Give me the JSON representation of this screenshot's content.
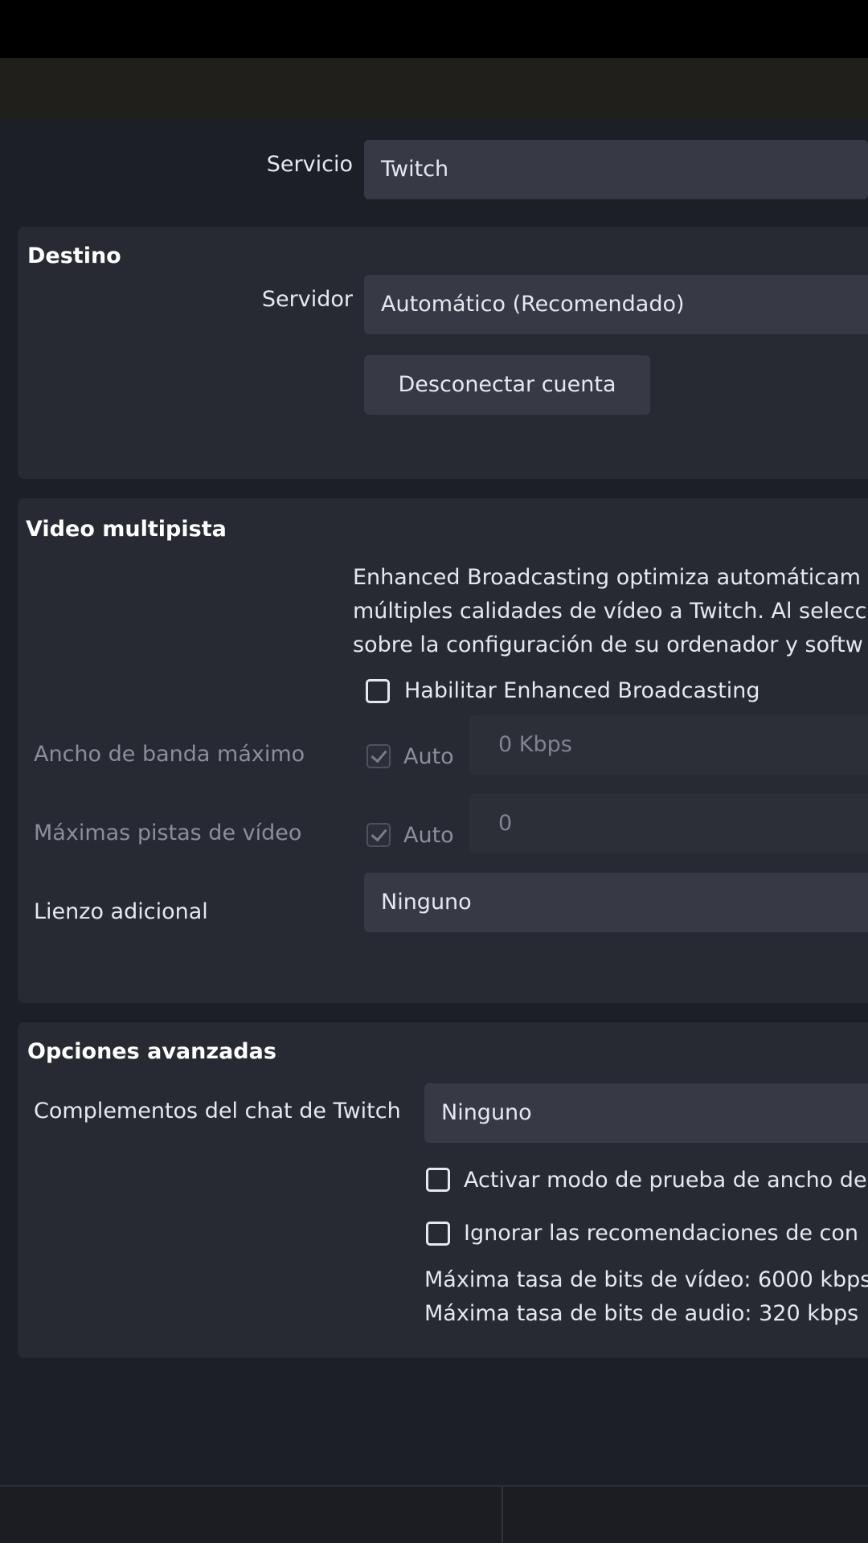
{
  "service": {
    "label": "Servicio",
    "value": "Twitch"
  },
  "destination": {
    "title": "Destino",
    "server_label": "Servidor",
    "server_value": "Automático (Recomendado)",
    "disconnect_button": "Desconectar cuenta"
  },
  "multitrack": {
    "title": "Video multipista",
    "description_lines": [
      "Enhanced Broadcasting optimiza automáticam",
      "múltiples calidades de vídeo a Twitch. Al selecc",
      "sobre la configuración de su ordenador y softw"
    ],
    "enable_label": "Habilitar Enhanced Broadcasting",
    "enable_checked": false,
    "bandwidth": {
      "label": "Ancho de banda máximo",
      "auto_label": "Auto",
      "auto_checked": true,
      "value": "0 Kbps"
    },
    "tracks": {
      "label": "Máximas pistas de vídeo",
      "auto_label": "Auto",
      "auto_checked": true,
      "value": "0"
    },
    "canvas": {
      "label": "Lienzo adicional",
      "value": "Ninguno"
    }
  },
  "advanced": {
    "title": "Opciones avanzadas",
    "chat_addons_label": "Complementos del chat de Twitch",
    "chat_addons_value": "Ninguno",
    "bandwidth_test_label": "Activar modo de prueba de ancho de",
    "bandwidth_test_checked": false,
    "ignore_recommendations_label": "Ignorar las recomendaciones de con",
    "ignore_recommendations_checked": false,
    "max_video_bitrate": "Máxima tasa de bits de vídeo: 6000 kbps",
    "max_audio_bitrate": "Máxima tasa de bits de audio: 320 kbps"
  },
  "colors": {
    "background": "#1d1f26",
    "group_background": "#272a33",
    "field_background": "#373a44",
    "text": "#e6e8ef",
    "disabled_text": "#8a8f9a"
  }
}
